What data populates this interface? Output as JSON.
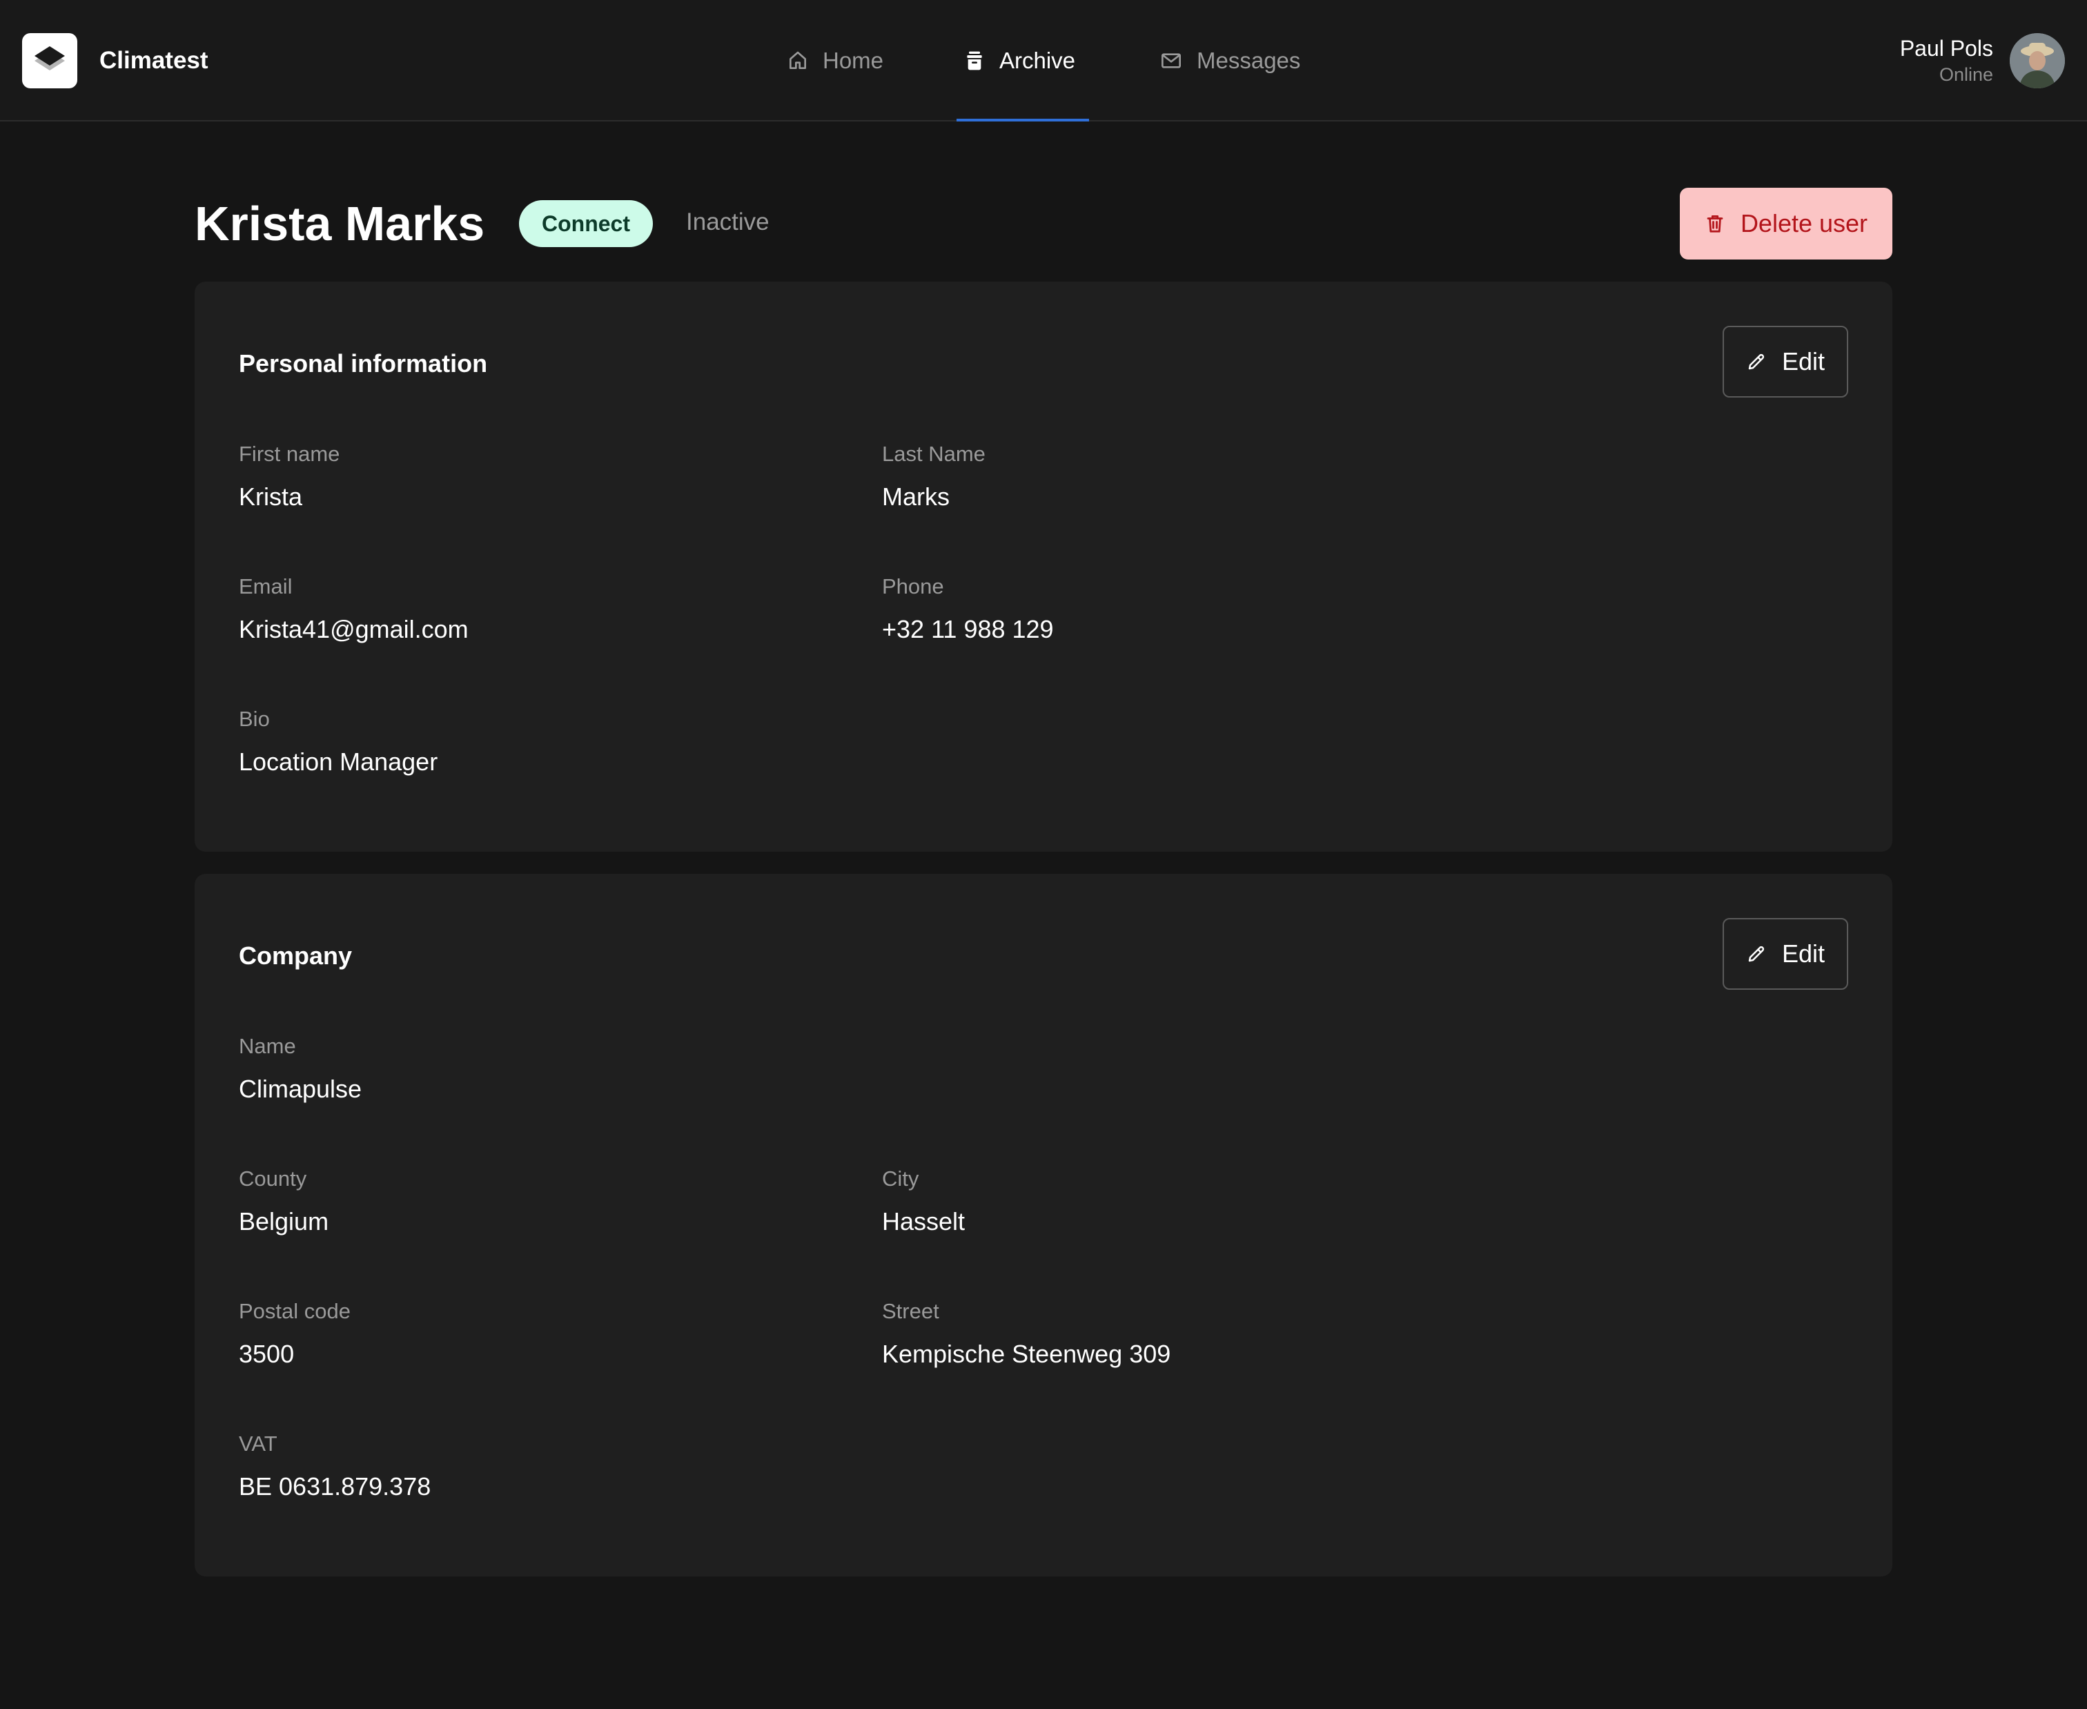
{
  "app": {
    "name": "Climatest"
  },
  "nav": {
    "tabs": [
      {
        "label": "Home",
        "icon": "home-icon"
      },
      {
        "label": "Archive",
        "icon": "archive-icon",
        "active": true
      },
      {
        "label": "Messages",
        "icon": "mail-icon"
      }
    ]
  },
  "user": {
    "name": "Paul Pols",
    "status": "Online"
  },
  "header": {
    "title": "Krista Marks",
    "badge": "Connect",
    "status": "Inactive",
    "delete_label": "Delete user"
  },
  "personal": {
    "title": "Personal information",
    "edit_label": "Edit",
    "first_name_label": "First name",
    "first_name": "Krista",
    "last_name_label": "Last Name",
    "last_name": "Marks",
    "email_label": "Email",
    "email": "Krista41@gmail.com",
    "phone_label": "Phone",
    "phone": "+32 11 988 129",
    "bio_label": "Bio",
    "bio": "Location Manager"
  },
  "company": {
    "title": "Company",
    "edit_label": "Edit",
    "name_label": "Name",
    "name": "Climapulse",
    "county_label": "County",
    "county": "Belgium",
    "city_label": "City",
    "city": "Hasselt",
    "postal_label": "Postal code",
    "postal": "3500",
    "street_label": "Street",
    "street": "Kempische Steenweg 309",
    "vat_label": "VAT",
    "vat": "BE 0631.879.378"
  },
  "colors": {
    "background": "#151515",
    "card": "#1f1f1f",
    "accent_blue": "#2f6fd8",
    "badge_bg": "#cdfbe9",
    "danger_bg": "#fbc5c5",
    "danger_text": "#b3151b"
  }
}
